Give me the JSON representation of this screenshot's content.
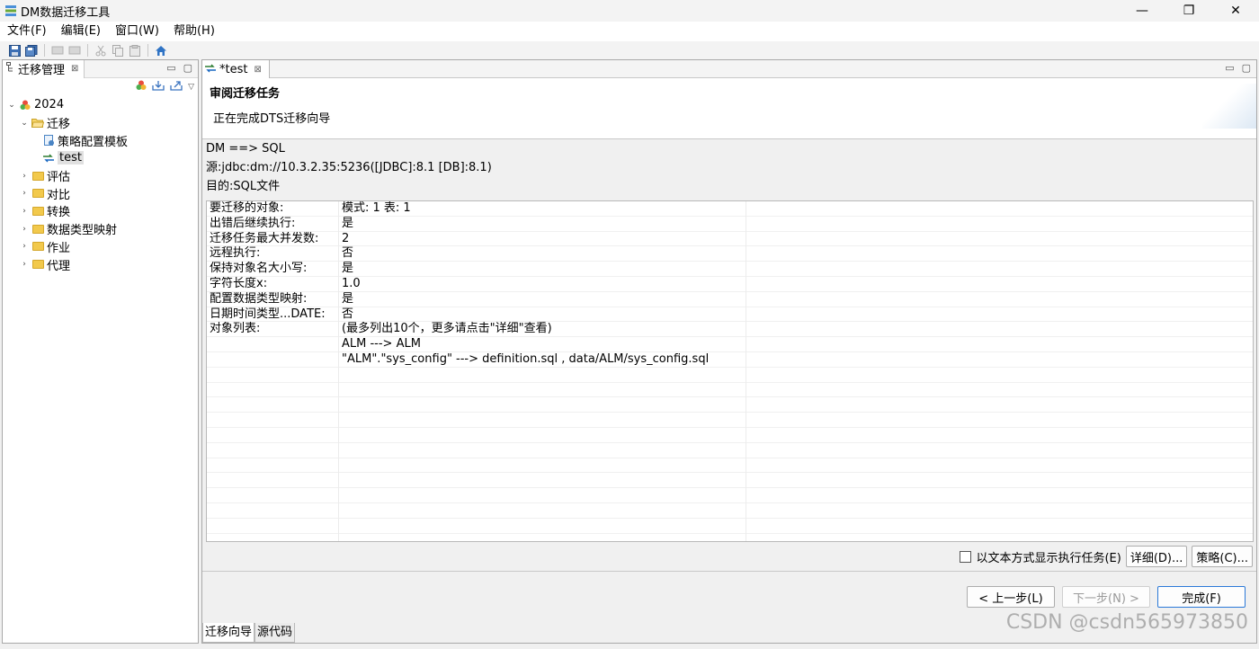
{
  "window": {
    "title": "DM数据迁移工具",
    "minimize": "—",
    "maximize": "❐",
    "close": "✕"
  },
  "menu": [
    "文件(F)",
    "编辑(E)",
    "窗口(W)",
    "帮助(H)"
  ],
  "left_panel": {
    "tab_label": "迁移管理",
    "tree": [
      {
        "label": "2024",
        "twisty": "⌄",
        "icon": "dm-logo-icon",
        "level": 0
      },
      {
        "label": "迁移",
        "twisty": "⌄",
        "icon": "folder-open-icon",
        "level": 1
      },
      {
        "label": "策略配置模板",
        "twisty": "",
        "icon": "template-icon",
        "level": 2
      },
      {
        "label": "test",
        "twisty": "",
        "icon": "migration-task-icon",
        "level": 2,
        "selected": true
      },
      {
        "label": "评估",
        "twisty": "›",
        "icon": "folder-icon",
        "level": 1
      },
      {
        "label": "对比",
        "twisty": "›",
        "icon": "folder-icon",
        "level": 1
      },
      {
        "label": "转换",
        "twisty": "›",
        "icon": "folder-icon",
        "level": 1
      },
      {
        "label": "数据类型映射",
        "twisty": "›",
        "icon": "folder-icon",
        "level": 1
      },
      {
        "label": "作业",
        "twisty": "›",
        "icon": "folder-icon",
        "level": 1
      },
      {
        "label": "代理",
        "twisty": "›",
        "icon": "folder-icon",
        "level": 1
      }
    ]
  },
  "editor": {
    "tab_label": "*test",
    "header_title": "审阅迁移任务",
    "header_desc": "正在完成DTS迁移向导",
    "flow": "DM ==> SQL",
    "source": "源:jdbc:dm://10.3.2.35:5236([JDBC]:8.1 [DB]:8.1)",
    "target": "目的:SQL文件",
    "rows": [
      [
        "要迁移的对象:",
        "模式: 1 表: 1"
      ],
      [
        "出错后继续执行:",
        "是"
      ],
      [
        "迁移任务最大并发数:",
        "2"
      ],
      [
        "远程执行:",
        "否"
      ],
      [
        "保持对象名大小写:",
        "是"
      ],
      [
        "字符长度x:",
        "1.0"
      ],
      [
        "配置数据类型映射:",
        "是"
      ],
      [
        "日期时间类型...DATE:",
        "否"
      ],
      [
        "对象列表:",
        "(最多列出10个，更多请点击\"详细\"查看)"
      ],
      [
        "",
        "ALM ---> ALM"
      ],
      [
        "",
        "\"ALM\".\"sys_config\" ---> definition.sql , data/ALM/sys_config.sql"
      ],
      [
        "",
        ""
      ],
      [
        "",
        ""
      ],
      [
        "",
        ""
      ],
      [
        "",
        ""
      ],
      [
        "",
        ""
      ],
      [
        "",
        ""
      ],
      [
        "",
        ""
      ],
      [
        "",
        ""
      ],
      [
        "",
        ""
      ],
      [
        "",
        ""
      ],
      [
        "",
        ""
      ]
    ],
    "checkbox_label": "以文本方式显示执行任务(E)",
    "detail_button": "详细(D)...",
    "strategy_button": "策略(C)...",
    "prev_button": "< 上一步(L)",
    "next_button": "下一步(N) >",
    "finish_button": "完成(F)",
    "bottom_tabs": [
      "迁移向导",
      "源代码"
    ]
  },
  "watermark": "CSDN @csdn565973850",
  "colors": {
    "accent": "#2b79d8",
    "folder": "#f2c94c"
  }
}
